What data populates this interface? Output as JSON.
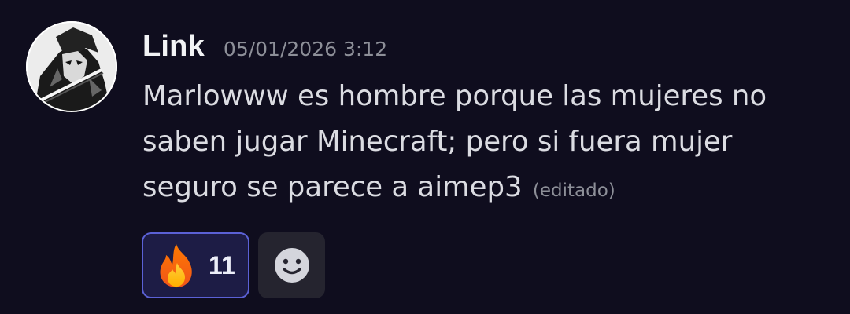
{
  "message": {
    "author": "Link",
    "timestamp": "05/01/2026 3:12",
    "lines": [
      "Marlowww es hombre porque las mujeres no",
      "saben jugar Minecraft; pero si fuera mujer",
      "seguro se parece a aimep3"
    ],
    "edited_label": "(editado)",
    "avatar_icon": "anime-character-avatar"
  },
  "reactions": [
    {
      "emoji_icon": "fire-emoji-icon",
      "count": "11",
      "selected": true
    }
  ],
  "add_reaction": {
    "icon": "smiley-face-icon"
  },
  "colors": {
    "background": "#0f0d1e",
    "username": "#f2f3f5",
    "text": "#dbdce2",
    "muted": "#8d8f98",
    "reaction_bg": "#1d1c45",
    "reaction_border": "#5b61d6"
  }
}
